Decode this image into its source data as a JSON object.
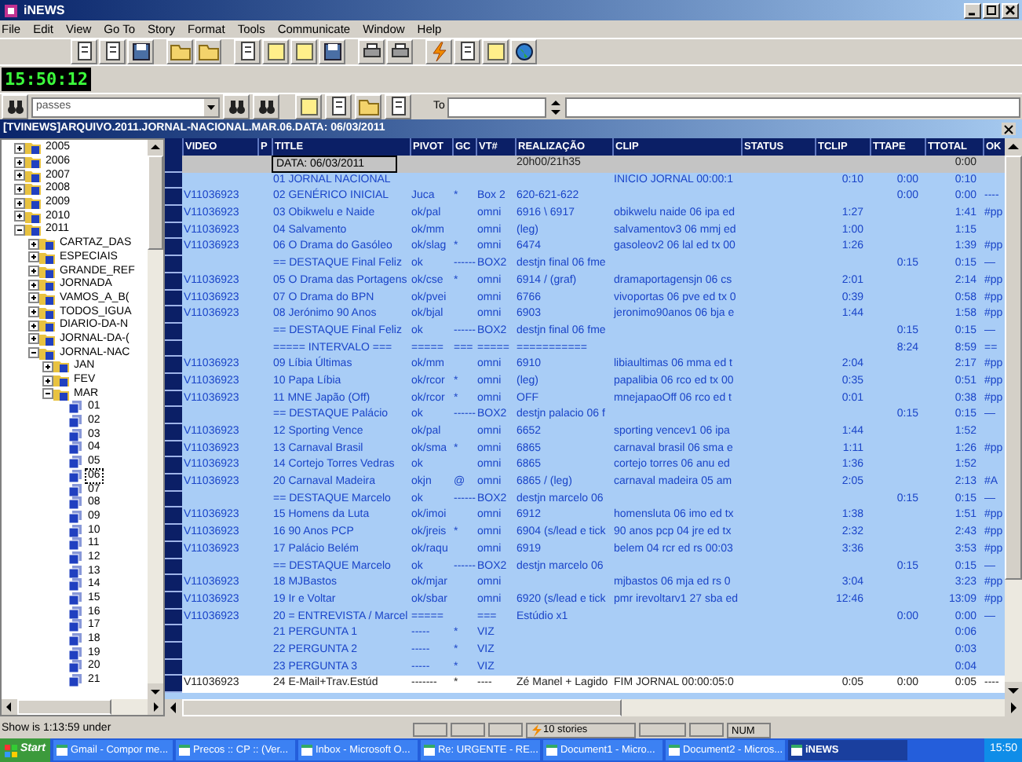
{
  "window": {
    "title": "iNEWS"
  },
  "menu": [
    "File",
    "Edit",
    "View",
    "Go To",
    "Story",
    "Format",
    "Tools",
    "Communicate",
    "Window",
    "Help"
  ],
  "clock": "15:50:12",
  "search": {
    "value": "passes",
    "to_label": "To"
  },
  "document": {
    "title": "[TVINEWS]ARQUIVO.2011.JORNAL-NACIONAL.MAR.06.DATA: 06/03/2011"
  },
  "tree": [
    {
      "label": "2005",
      "expanded": false,
      "selected": false
    },
    {
      "label": "2006",
      "expanded": false,
      "selected": false
    },
    {
      "label": "2007",
      "expanded": false,
      "selected": false
    },
    {
      "label": "2008",
      "expanded": false,
      "selected": false
    },
    {
      "label": "2009",
      "expanded": false,
      "selected": false
    },
    {
      "label": "2010",
      "expanded": false,
      "selected": false
    },
    {
      "label": "2011",
      "expanded": true,
      "selected": false,
      "children": [
        {
          "label": "CARTAZ_DAS",
          "expanded": false,
          "selected": false
        },
        {
          "label": "ESPECIAIS",
          "expanded": false,
          "selected": false
        },
        {
          "label": "GRANDE_REF",
          "expanded": false,
          "selected": false
        },
        {
          "label": "JORNADA",
          "expanded": false,
          "selected": false
        },
        {
          "label": "VAMOS_A_B(",
          "expanded": false,
          "selected": false
        },
        {
          "label": "TODOS_IGUA",
          "expanded": false,
          "selected": false
        },
        {
          "label": "DIARIO-DA-N",
          "expanded": false,
          "selected": false
        },
        {
          "label": "JORNAL-DA-(",
          "expanded": false,
          "selected": false
        },
        {
          "label": "JORNAL-NAC",
          "expanded": true,
          "selected": false,
          "children": [
            {
              "label": "JAN",
              "expanded": false,
              "selected": false
            },
            {
              "label": "FEV",
              "expanded": false,
              "selected": false
            },
            {
              "label": "MAR",
              "expanded": true,
              "selected": false,
              "children": [
                {
                  "label": "01",
                  "selected": false
                },
                {
                  "label": "02",
                  "selected": false
                },
                {
                  "label": "03",
                  "selected": false
                },
                {
                  "label": "04",
                  "selected": false
                },
                {
                  "label": "05",
                  "selected": false
                },
                {
                  "label": "06",
                  "selected": true
                },
                {
                  "label": "07",
                  "selected": false
                },
                {
                  "label": "08",
                  "selected": false
                },
                {
                  "label": "09",
                  "selected": false
                },
                {
                  "label": "10",
                  "selected": false
                },
                {
                  "label": "11",
                  "selected": false
                },
                {
                  "label": "12",
                  "selected": false
                },
                {
                  "label": "13",
                  "selected": false
                },
                {
                  "label": "14",
                  "selected": false
                },
                {
                  "label": "15",
                  "selected": false
                },
                {
                  "label": "16",
                  "selected": false
                },
                {
                  "label": "17",
                  "selected": false
                },
                {
                  "label": "18",
                  "selected": false
                },
                {
                  "label": "19",
                  "selected": false
                },
                {
                  "label": "20",
                  "selected": false
                },
                {
                  "label": "21",
                  "selected": false
                }
              ]
            }
          ]
        }
      ]
    }
  ],
  "table": {
    "columns": [
      {
        "label": "VIDEO"
      },
      {
        "label": "P"
      },
      {
        "label": "TITLE"
      },
      {
        "label": "PIVOT"
      },
      {
        "label": "GC"
      },
      {
        "label": "VT#"
      },
      {
        "label": "REALIZAÇÃO"
      },
      {
        "label": "CLIP"
      },
      {
        "label": "STATUS"
      },
      {
        "label": "TCLIP"
      },
      {
        "label": "TTAPE"
      },
      {
        "label": "TTOTAL"
      },
      {
        "label": "OK"
      }
    ],
    "rows": [
      {
        "kind": "date",
        "selected": false,
        "title": "DATA: 06/03/2011",
        "realizacao": "20h00/21h35",
        "ttotal": "0:00"
      },
      {
        "kind": "story",
        "selected": false,
        "title": "01 JORNAL NACIONAL",
        "clip": "INICIO JORNAL 00:00:1",
        "tclip": "0:10",
        "ttape": "0:00",
        "ttotal": "0:10"
      },
      {
        "kind": "story",
        "selected": false,
        "video": "V11036923",
        "title": "02 GENÉRICO INICIAL",
        "pivot": "Juca",
        "gc": "*",
        "vt": "Box 2",
        "realizacao": "620-621-622",
        "ttape": "0:00",
        "ttotal": "0:00",
        "ok": "----"
      },
      {
        "kind": "story",
        "selected": false,
        "video": "V11036923",
        "title": "03 Obikwelu e Naide",
        "pivot": "ok/pal",
        "vt": "omni",
        "realizacao": "6916 \\ 6917",
        "clip": "obikwelu naide 06 ipa ed",
        "tclip": "1:27",
        "ttotal": "1:41",
        "ok": "#pp"
      },
      {
        "kind": "story",
        "selected": false,
        "video": "V11036923",
        "title": "04 Salvamento",
        "pivot": "ok/mm",
        "vt": "omni",
        "realizacao": "(leg)",
        "clip": "salvamentov3 06 mmj ed",
        "tclip": "1:00",
        "ttotal": "1:15"
      },
      {
        "kind": "story",
        "selected": false,
        "video": "V11036923",
        "title": "06 O Drama do Gasóleo",
        "pivot": "ok/slag",
        "gc": "*",
        "vt": "omni",
        "realizacao": "6474",
        "clip": "gasoleov2 06 lal ed tx 00",
        "tclip": "1:26",
        "ttotal": "1:39",
        "ok": "#pp"
      },
      {
        "kind": "story",
        "selected": false,
        "title": "== DESTAQUE Final Feliz",
        "pivot": "ok",
        "gc": "------",
        "vt": "BOX2",
        "realizacao": "destjn final 06 fme",
        "ttape": "0:15",
        "ttotal": "0:15",
        "ok": "—"
      },
      {
        "kind": "story",
        "selected": false,
        "video": "V11036923",
        "title": "05 O Drama das Portagens",
        "pivot": "ok/cse",
        "gc": "*",
        "vt": "omni",
        "realizacao": "6914 / (graf)",
        "clip": "dramaportagensjn 06 cs",
        "tclip": "2:01",
        "ttotal": "2:14",
        "ok": "#pp"
      },
      {
        "kind": "story",
        "selected": false,
        "video": "V11036923",
        "title": "07 O Drama do BPN",
        "pivot": "ok/pvei",
        "vt": "omni",
        "realizacao": "6766",
        "clip": "vivoportas 06 pve ed tx 0",
        "tclip": "0:39",
        "ttotal": "0:58",
        "ok": "#pp"
      },
      {
        "kind": "story",
        "selected": false,
        "video": "V11036923",
        "title": "08 Jerónimo 90 Anos",
        "pivot": "ok/bjal",
        "vt": "omni",
        "realizacao": "6903",
        "clip": "jeronimo90anos 06 bja e",
        "tclip": "1:44",
        "ttotal": "1:58",
        "ok": "#pp"
      },
      {
        "kind": "story",
        "selected": false,
        "title": "== DESTAQUE Final Feliz",
        "pivot": "ok",
        "gc": "------",
        "vt": "BOX2",
        "realizacao": "destjn final 06 fme",
        "ttape": "0:15",
        "ttotal": "0:15",
        "ok": "—"
      },
      {
        "kind": "story",
        "selected": false,
        "title": "===== INTERVALO ===",
        "pivot": "=====",
        "gc": "===",
        "vt": "=====",
        "realizacao": "===========",
        "ttape": "8:24",
        "ttotal": "8:59",
        "ok": "=="
      },
      {
        "kind": "story",
        "selected": false,
        "video": "V11036923",
        "title": "09 Líbia Últimas",
        "pivot": "ok/mm",
        "vt": "omni",
        "realizacao": "6910",
        "clip": "libiaultimas 06 mma ed t",
        "tclip": "2:04",
        "ttotal": "2:17",
        "ok": "#pp"
      },
      {
        "kind": "story",
        "selected": false,
        "video": "V11036923",
        "title": "10 Papa Líbia",
        "pivot": "ok/rcor",
        "gc": "*",
        "vt": "omni",
        "realizacao": "(leg)",
        "clip": "papalibia 06 rco ed tx 00",
        "tclip": "0:35",
        "ttotal": "0:51",
        "ok": "#pp"
      },
      {
        "kind": "story",
        "selected": false,
        "video": "V11036923",
        "title": "11 MNE Japão  (Off)",
        "pivot": "ok/rcor",
        "gc": "*",
        "vt": "omni",
        "realizacao": "OFF",
        "clip": "mnejapaoOff 06 rco ed t",
        "tclip": "0:01",
        "ttotal": "0:38",
        "ok": "#pp"
      },
      {
        "kind": "story",
        "selected": false,
        "title": "== DESTAQUE Palácio",
        "pivot": "ok",
        "gc": "------",
        "vt": "BOX2",
        "realizacao": "destjn palacio 06 f",
        "ttape": "0:15",
        "ttotal": "0:15",
        "ok": "—"
      },
      {
        "kind": "story",
        "selected": false,
        "video": "V11036923",
        "title": "12 Sporting Vence",
        "pivot": "ok/pal",
        "vt": "omni",
        "realizacao": "6652",
        "clip": "sporting vencev1 06 ipa",
        "tclip": "1:44",
        "ttotal": "1:52"
      },
      {
        "kind": "story",
        "selected": false,
        "video": "V11036923",
        "title": "13 Carnaval Brasil",
        "pivot": "ok/sma",
        "gc": "*",
        "vt": "omni",
        "realizacao": "6865",
        "clip": "carnaval brasil 06 sma e",
        "tclip": "1:11",
        "ttotal": "1:26",
        "ok": "#pp"
      },
      {
        "kind": "story",
        "selected": false,
        "video": "V11036923",
        "title": "14 Cortejo Torres Vedras",
        "pivot": "ok",
        "vt": "omni",
        "realizacao": "6865",
        "clip": "cortejo torres 06 anu ed",
        "tclip": "1:36",
        "ttotal": "1:52"
      },
      {
        "kind": "story",
        "selected": false,
        "video": "V11036923",
        "title": "20 Carnaval Madeira",
        "pivot": "okjn",
        "gc": "@",
        "vt": "omni",
        "realizacao": "6865 / (leg)",
        "clip": "carnaval madeira 05 am",
        "tclip": "2:05",
        "ttotal": "2:13",
        "ok": "#A"
      },
      {
        "kind": "story",
        "selected": false,
        "title": "== DESTAQUE Marcelo",
        "pivot": "ok",
        "gc": "------",
        "vt": "BOX2",
        "realizacao": "destjn marcelo 06",
        "ttape": "0:15",
        "ttotal": "0:15",
        "ok": "—"
      },
      {
        "kind": "story",
        "selected": false,
        "video": "V11036923",
        "title": "15 Homens da Luta",
        "pivot": "ok/imoi",
        "vt": "omni",
        "realizacao": "6912",
        "clip": "homensluta 06 imo ed tx",
        "tclip": "1:38",
        "ttotal": "1:51",
        "ok": "#pp"
      },
      {
        "kind": "story",
        "selected": false,
        "video": "V11036923",
        "title": "16 90 Anos PCP",
        "pivot": "ok/jreis",
        "gc": "*",
        "vt": "omni",
        "realizacao": "6904 (s/lead e tick",
        "clip": "90 anos pcp 04 jre ed tx",
        "tclip": "2:32",
        "ttotal": "2:43",
        "ok": "#pp"
      },
      {
        "kind": "story",
        "selected": false,
        "video": "V11036923",
        "title": "17 Palácio Belém",
        "pivot": "ok/raqu",
        "vt": "omni",
        "realizacao": "6919",
        "clip": "belem 04 rcr ed rs 00:03",
        "tclip": "3:36",
        "ttotal": "3:53",
        "ok": "#pp"
      },
      {
        "kind": "story",
        "selected": false,
        "title": "== DESTAQUE Marcelo",
        "pivot": "ok",
        "gc": "------",
        "vt": "BOX2",
        "realizacao": "destjn marcelo 06",
        "ttape": "0:15",
        "ttotal": "0:15",
        "ok": "—"
      },
      {
        "kind": "story",
        "selected": false,
        "video": "V11036923",
        "title": "18 MJBastos",
        "pivot": "ok/mjar",
        "vt": "omni",
        "clip": "mjbastos 06 mja ed rs 0",
        "tclip": "3:04",
        "ttotal": "3:23",
        "ok": "#pp"
      },
      {
        "kind": "story",
        "selected": false,
        "video": "V11036923",
        "title": "19 Ir e Voltar",
        "pivot": "ok/sbar",
        "vt": "omni",
        "realizacao": "6920 (s/lead e tick",
        "clip": "pmr irevoltarv1 27 sba ed",
        "tclip": "12:46",
        "ttotal": "13:09",
        "ok": "#pp"
      },
      {
        "kind": "story",
        "selected": false,
        "video": "V11036923",
        "title": "20 = ENTREVISTA / Marcel",
        "pivot": "=====",
        "vt": "===",
        "realizacao": "Estúdio x1",
        "ttape": "0:00",
        "ttotal": "0:00",
        "ok": "—"
      },
      {
        "kind": "story",
        "selected": false,
        "title": "21 PERGUNTA 1",
        "pivot": "-----",
        "gc": "*",
        "vt": "VIZ",
        "ttotal": "0:06"
      },
      {
        "kind": "story",
        "selected": false,
        "title": "22 PERGUNTA 2",
        "pivot": "-----",
        "gc": "*",
        "vt": "VIZ",
        "ttotal": "0:03"
      },
      {
        "kind": "story",
        "selected": false,
        "title": "23 PERGUNTA 3",
        "pivot": "-----",
        "gc": "*",
        "vt": "VIZ",
        "ttotal": "0:04"
      },
      {
        "kind": "story",
        "selected": true,
        "video": "V11036923",
        "title": "24 E-Mail+Trav.Estúd",
        "pivot": "-------",
        "gc": "*",
        "vt": "----",
        "realizacao": "Zé Manel + Lagido",
        "clip": "FIM JORNAL 00:00:05:0",
        "tclip": "0:05",
        "ttape": "0:00",
        "ttotal": "0:05",
        "ok": "----"
      }
    ]
  },
  "status_bar": {
    "message": "Show is 1:13:59 under",
    "stories": "10 stories",
    "num": "NUM"
  },
  "taskbar": {
    "start": "Start",
    "items": [
      {
        "label": "Gmail - Compor me...",
        "selected": false
      },
      {
        "label": "Precos :: CP :: (Ver...",
        "selected": false
      },
      {
        "label": "Inbox - Microsoft O...",
        "selected": false
      },
      {
        "label": "Re: URGENTE - RE...",
        "selected": false
      },
      {
        "label": "Document1 - Micro...",
        "selected": false
      },
      {
        "label": "Document2 - Micros...",
        "selected": false
      },
      {
        "label": "iNEWS",
        "selected": true
      }
    ],
    "time": "15:50"
  }
}
